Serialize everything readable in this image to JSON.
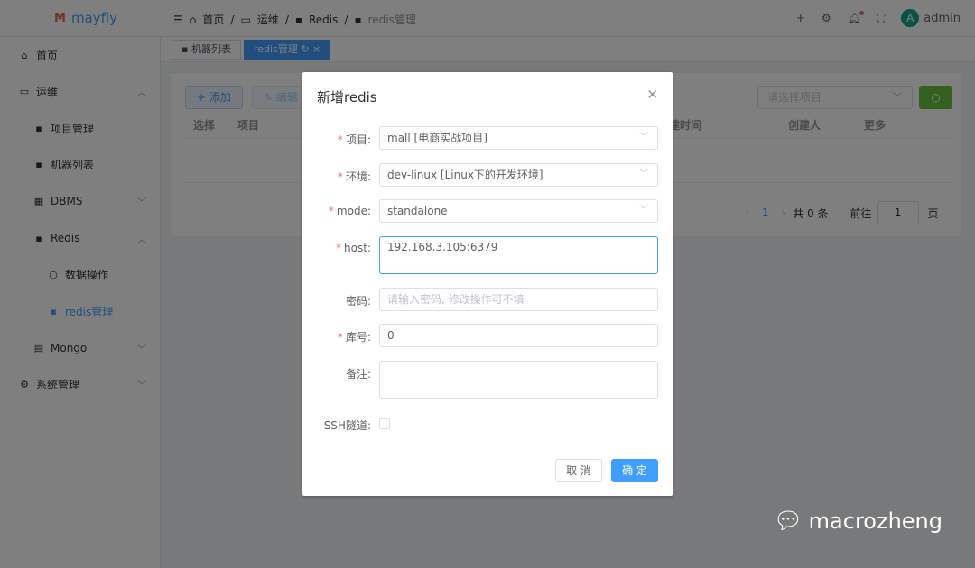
{
  "app": {
    "name": "mayfly",
    "logo_mark": "M"
  },
  "breadcrumb": [
    "首页",
    "运维",
    "Redis",
    "redis管理"
  ],
  "header": {
    "user": "admin",
    "avatar_letter": "A"
  },
  "sidebar": [
    {
      "label": "首页",
      "icon": "home-icon"
    },
    {
      "label": "运维",
      "icon": "monitor-icon",
      "expanded": true
    },
    {
      "label": "项目管理",
      "icon": "grid-icon",
      "sub": true
    },
    {
      "label": "机器列表",
      "icon": "grid-icon",
      "sub": true
    },
    {
      "label": "DBMS",
      "icon": "grid-icon",
      "sub": true
    },
    {
      "label": "Redis",
      "icon": "grid-icon",
      "sub": true,
      "expanded": true
    },
    {
      "label": "数据操作",
      "icon": "search-icon",
      "sub2": true
    },
    {
      "label": "redis管理",
      "icon": "grid-icon",
      "sub2": true,
      "active": true
    },
    {
      "label": "Mongo",
      "icon": "document-icon",
      "sub": true
    },
    {
      "label": "系统管理",
      "icon": "gear-icon"
    }
  ],
  "tabs": [
    {
      "label": "机器列表"
    },
    {
      "label": "redis管理",
      "active": true
    }
  ],
  "toolbar": {
    "add": "添加",
    "edit": "编辑",
    "project_placeholder": "请选择项目"
  },
  "table": {
    "columns": [
      "选择",
      "项目",
      "创建时间",
      "创建人",
      "更多"
    ]
  },
  "pagination": {
    "page": "1",
    "total": "共 0 条",
    "goto": "前往",
    "goto_value": "1",
    "page_suffix": "页"
  },
  "dialog": {
    "title": "新增redis",
    "fields": [
      {
        "label": "项目:",
        "value": "mall [电商实战项目]",
        "required": true
      },
      {
        "label": "环境:",
        "value": "dev-linux [Linux下的开发环境]",
        "required": true
      },
      {
        "label": "mode:",
        "value": "standalone",
        "required": true
      },
      {
        "label": "host:",
        "value": "192.168.3.105:6379",
        "required": true
      },
      {
        "label": "密码:",
        "placeholder": "请输入密码, 修改操作可不填"
      },
      {
        "label": "库号:",
        "value": "0",
        "required": true
      },
      {
        "label": "备注:",
        "value": ""
      },
      {
        "label": "SSH隧道:",
        "checked": false
      }
    ],
    "cancel": "取 消",
    "ok": "确 定"
  },
  "watermark": "macrozheng",
  "colors": {
    "primary": "#409eff",
    "success": "#67c23a",
    "danger": "#f56c6c"
  }
}
